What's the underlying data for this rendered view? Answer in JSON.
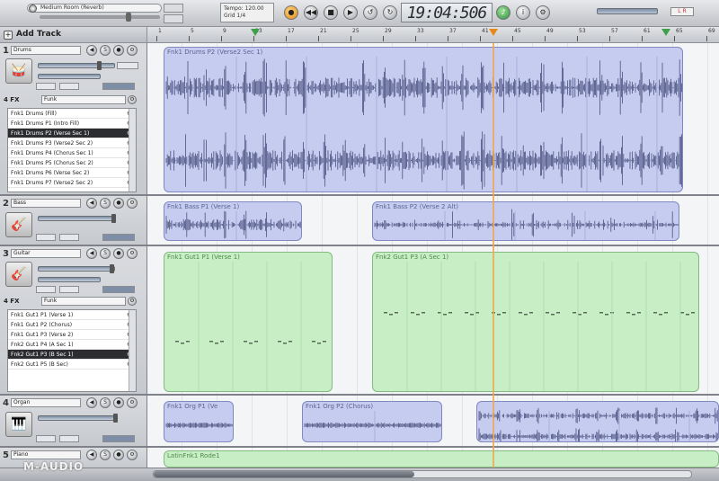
{
  "transport": {
    "reverb_preset": "Medium Room (Reverb)",
    "tempo_label": "Tempo: 120.00",
    "grid_label": "Grid  1/4",
    "time_display": "19:04:506",
    "out_label": "L R",
    "buttons": [
      "record",
      "rewind",
      "stop",
      "play",
      "loop",
      "cycle",
      "metronome",
      "info"
    ]
  },
  "add_track_label": "Add Track",
  "ruler": {
    "labels": [
      "1",
      "5",
      "9",
      "13",
      "17",
      "21",
      "25",
      "29",
      "33",
      "37",
      "41",
      "45",
      "49",
      "53",
      "57",
      "61",
      "65",
      "69"
    ]
  },
  "tracks": [
    {
      "number": "1",
      "name": "Drums",
      "icon": "drum-kit-icon",
      "fx_label": "4 FX",
      "fx_preset": "Funk",
      "loops": [
        {
          "label": "Fnk1 Drums (Fill)"
        },
        {
          "label": "Fnk1 Drums P1 (Intro Fill)"
        },
        {
          "label": "Fnk1 Drums P2 (Verse Sec 1)",
          "selected": true
        },
        {
          "label": "Fnk1 Drums P3 (Verse2 Sec 2)"
        },
        {
          "label": "Fnk1 Drums P4 (Chorus Sec 1)"
        },
        {
          "label": "Fnk1 Drums P5 (Chorus Sec 2)"
        },
        {
          "label": "Fnk1 Drums P6 (Verse Sec 2)"
        },
        {
          "label": "Fnk1 Drums P7 (Verse2 Sec 2)"
        }
      ],
      "clips": [
        {
          "name": "Fnk1 Drums P2 (Verse2 Sec 1)",
          "color": "blue"
        }
      ]
    },
    {
      "number": "2",
      "name": "Bass",
      "icon": "bass-guitar-icon",
      "clips": [
        {
          "name": "Fnk1 Bass P1 (Verse 1)",
          "color": "blue"
        },
        {
          "name": "Fnk1 Bass P2 (Verse 2 Alt)",
          "color": "blue"
        }
      ]
    },
    {
      "number": "3",
      "name": "Guitar",
      "icon": "electric-guitar-icon",
      "fx_label": "4 FX",
      "fx_preset": "Funk",
      "loops": [
        {
          "label": "Fnk1 Gut1 P1 (Verse 1)"
        },
        {
          "label": "Fnk1 Gut1 P2 (Chorus)"
        },
        {
          "label": "Fnk1 Gut1 P3 (Verse 2)"
        },
        {
          "label": "Fnk2 Gut1 P4 (A Sec 1)"
        },
        {
          "label": "Fnk2 Gut1 P3 (B Sec 1)",
          "selected": true
        },
        {
          "label": "Fnk2 Gut1 P5 (B Sec)"
        }
      ],
      "clips": [
        {
          "name": "Fnk1 Gut1 P1 (Verse 1)",
          "color": "green"
        },
        {
          "name": "Fnk2 Gut1 P3 (A Sec 1)",
          "color": "green"
        }
      ]
    },
    {
      "number": "4",
      "name": "Organ",
      "icon": "organ-icon",
      "clips": [
        {
          "name": "Fnk1 Org P1 (Ve",
          "color": "blue"
        },
        {
          "name": "Fnk1 Org P2 (Chorus)",
          "color": "blue"
        },
        {
          "name": "",
          "color": "blue"
        }
      ]
    },
    {
      "number": "5",
      "name": "Piano",
      "icon": "piano-icon",
      "clips": [
        {
          "name": "LatinFnk1 Rode1",
          "color": "green"
        }
      ]
    }
  ],
  "brand": "M-AUDIO",
  "colors": {
    "audio_clip": "#c5ccef",
    "midi_clip": "#c7eec4",
    "playhead": "#f0a64a",
    "selected_loop": "#2c2d31"
  }
}
